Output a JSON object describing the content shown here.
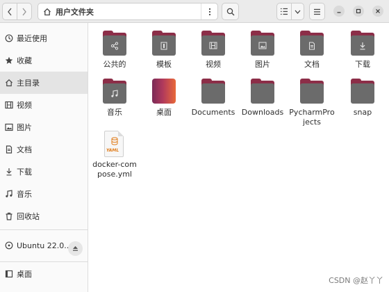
{
  "header": {
    "path_label": "用户文件夹"
  },
  "sidebar": {
    "items": [
      {
        "label": "最近使用",
        "icon": "clock-icon"
      },
      {
        "label": "收藏",
        "icon": "star-icon"
      },
      {
        "label": "主目录",
        "icon": "home-icon",
        "active": true
      },
      {
        "label": "视频",
        "icon": "film-icon"
      },
      {
        "label": "图片",
        "icon": "picture-icon"
      },
      {
        "label": "文档",
        "icon": "document-icon"
      },
      {
        "label": "下载",
        "icon": "download-icon"
      },
      {
        "label": "音乐",
        "icon": "music-icon"
      },
      {
        "label": "回收站",
        "icon": "trash-icon"
      }
    ],
    "volume": {
      "label": "Ubuntu 22.0...",
      "icon": "disc-icon"
    },
    "bookmark": {
      "label": "桌面",
      "icon": "desktop-icon"
    }
  },
  "files": [
    {
      "name": "公共的",
      "kind": "folder",
      "emblem": "share-icon"
    },
    {
      "name": "模板",
      "kind": "folder",
      "emblem": "template-icon"
    },
    {
      "name": "视频",
      "kind": "folder",
      "emblem": "film-icon"
    },
    {
      "name": "图片",
      "kind": "folder",
      "emblem": "picture-icon"
    },
    {
      "name": "文档",
      "kind": "folder",
      "emblem": "document-icon"
    },
    {
      "name": "下载",
      "kind": "folder",
      "emblem": "download-icon"
    },
    {
      "name": "音乐",
      "kind": "folder",
      "emblem": "music-icon"
    },
    {
      "name": "桌面",
      "kind": "folder",
      "emblem": "desktop-gradient"
    },
    {
      "name": "Documents",
      "kind": "folder"
    },
    {
      "name": "Downloads",
      "kind": "folder"
    },
    {
      "name": "PycharmProjects",
      "kind": "folder"
    },
    {
      "name": "snap",
      "kind": "folder"
    },
    {
      "name": "docker-compose.yml",
      "kind": "yaml-file",
      "tag": "YAML"
    }
  ],
  "watermark": "CSDN @赵丫丫",
  "colors": {
    "folder_tab": "#8c2e48",
    "folder_body": "#6b6b6b",
    "active_row": "#e4e4e4"
  }
}
